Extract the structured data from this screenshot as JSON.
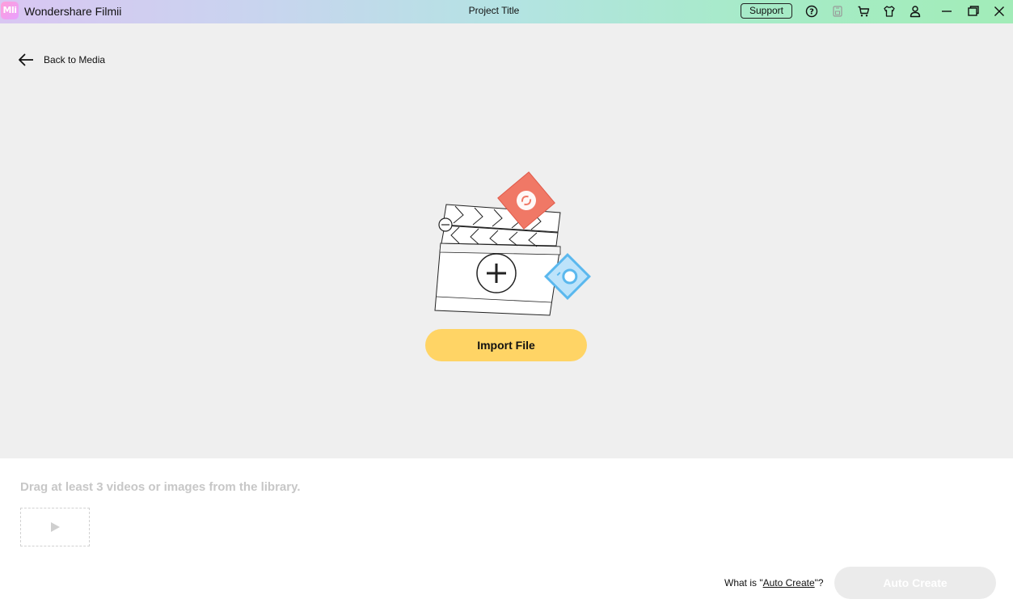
{
  "titlebar": {
    "logo_text": "Mli",
    "app_name": "Wondershare Filmii",
    "project_title": "Project Title",
    "support_label": "Support",
    "icons": [
      "help-icon",
      "save-icon",
      "cart-icon",
      "gift-icon",
      "user-icon",
      "minimize-icon",
      "maximize-icon",
      "close-icon"
    ]
  },
  "main": {
    "back_label": "Back to Media",
    "import_label": "Import File"
  },
  "lower": {
    "drag_hint": "Drag at least 3 videos or images from the library.",
    "what_is_prefix": "What is \"",
    "what_is_link": "Auto Create",
    "what_is_suffix": "\"?",
    "auto_create_label": "Auto Create"
  },
  "colors": {
    "import_button": "#ffd465",
    "auto_create_disabled": "#ebebeb",
    "main_background": "#efefef"
  }
}
